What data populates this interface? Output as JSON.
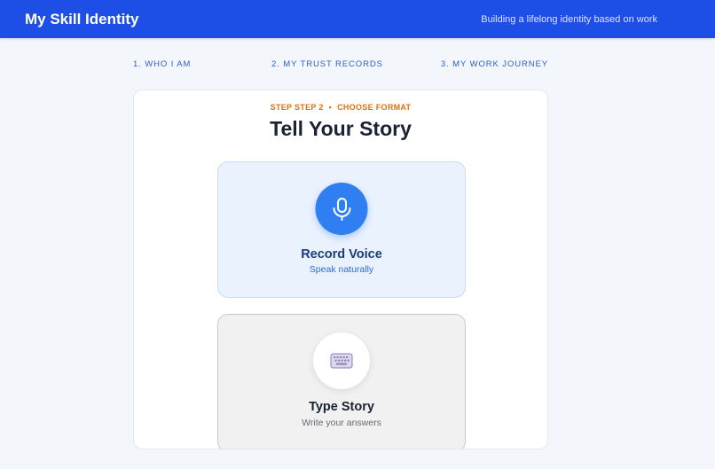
{
  "header": {
    "app_title": "My Skill Identity",
    "tagline": "Building a lifelong identity based on work"
  },
  "steps": [
    {
      "label": "1. WHO I AM"
    },
    {
      "label": "2. MY TRUST RECORDS"
    },
    {
      "label": "3. MY WORK JOURNEY"
    }
  ],
  "card": {
    "step_label": "STEP STEP 2",
    "separator": "•",
    "format_label": "CHOOSE FORMAT",
    "title": "Tell Your Story",
    "options": [
      {
        "title": "Record Voice",
        "subtitle": "Speak naturally",
        "icon": "microphone-icon"
      },
      {
        "title": "Type Story",
        "subtitle": "Write your answers",
        "icon": "keyboard-icon"
      }
    ]
  },
  "colors": {
    "header_bg": "#1d4fe6",
    "accent_orange": "#d9730d",
    "mic_blue": "#2f7ff2",
    "step_blue": "#2a5fd3"
  }
}
